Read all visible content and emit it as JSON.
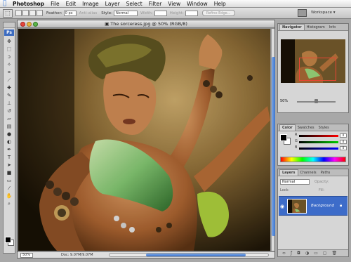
{
  "menubar": {
    "items": [
      "Photoshop",
      "File",
      "Edit",
      "Image",
      "Layer",
      "Select",
      "Filter",
      "View",
      "Window",
      "Help"
    ]
  },
  "options": {
    "feather_label": "Feather:",
    "feather_value": "0 px",
    "antialias_label": "Anti-alias",
    "style_label": "Style:",
    "style_value": "Normal",
    "width_label": "Width:",
    "height_label": "Height:",
    "refine_label": "Refine Edge...",
    "workspace_label": "Workspace ▾"
  },
  "toolbox": {
    "logo": "Ps",
    "tools": [
      "move-tool",
      "marquee-tool",
      "lasso-tool",
      "magic-wand-tool",
      "crop-tool",
      "slice-tool",
      "healing-brush-tool",
      "brush-tool",
      "clone-stamp-tool",
      "history-brush-tool",
      "eraser-tool",
      "gradient-tool",
      "blur-tool",
      "dodge-tool",
      "pen-tool",
      "type-tool",
      "path-selection-tool",
      "shape-tool",
      "notes-tool",
      "eyedropper-tool",
      "hand-tool",
      "zoom-tool"
    ],
    "foreground_color": "#000000",
    "background_color": "#ffffff"
  },
  "document": {
    "title": "The sorceress.jpg @ 50% (RGB/8)",
    "zoom": "50%",
    "doc_info": "Doc: 9.07M/9.07M"
  },
  "navigator": {
    "tabs": [
      "Navigator",
      "Histogram",
      "Info"
    ],
    "zoom": "50%"
  },
  "color_panel": {
    "tabs": [
      "Color",
      "Swatches",
      "Styles"
    ],
    "channels": [
      {
        "label": "R",
        "value": "0"
      },
      {
        "label": "G",
        "value": "0"
      },
      {
        "label": "B",
        "value": "0"
      }
    ]
  },
  "layers_panel": {
    "tabs": [
      "Layers",
      "Channels",
      "Paths"
    ],
    "blend_mode": "Normal",
    "opacity_label": "Opacity:",
    "lock_label": "Lock:",
    "fill_label": "Fill:",
    "layer_name": "Background"
  },
  "colors": {
    "accent_blue": "#3d6cc9",
    "canvas_bg": "#2a200e"
  }
}
